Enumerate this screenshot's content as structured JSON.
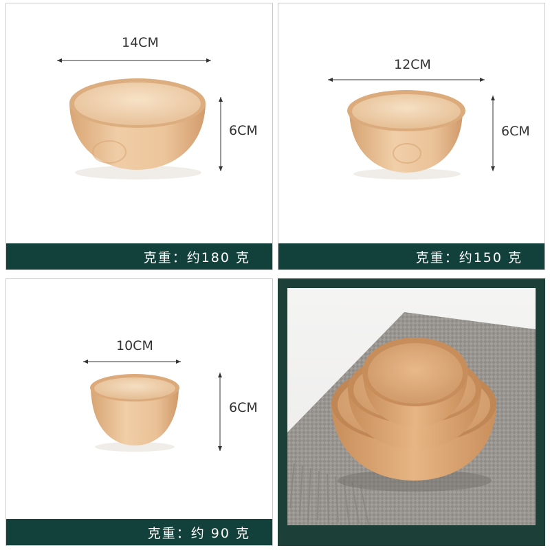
{
  "panels": [
    {
      "width_label": "14CM",
      "height_label": "6CM",
      "weight_label": "克重：约180 克"
    },
    {
      "width_label": "12CM",
      "height_label": "6CM",
      "weight_label": "克重：约150 克"
    },
    {
      "width_label": "10CM",
      "height_label": "6CM",
      "weight_label": "克重：约 90 克"
    }
  ],
  "colors": {
    "accent": "#12403a",
    "wood_light": "#f3d7b6",
    "wood_mid": "#e6bf93",
    "wood_dark": "#cf9a69",
    "cloth": "#8f8c88"
  }
}
